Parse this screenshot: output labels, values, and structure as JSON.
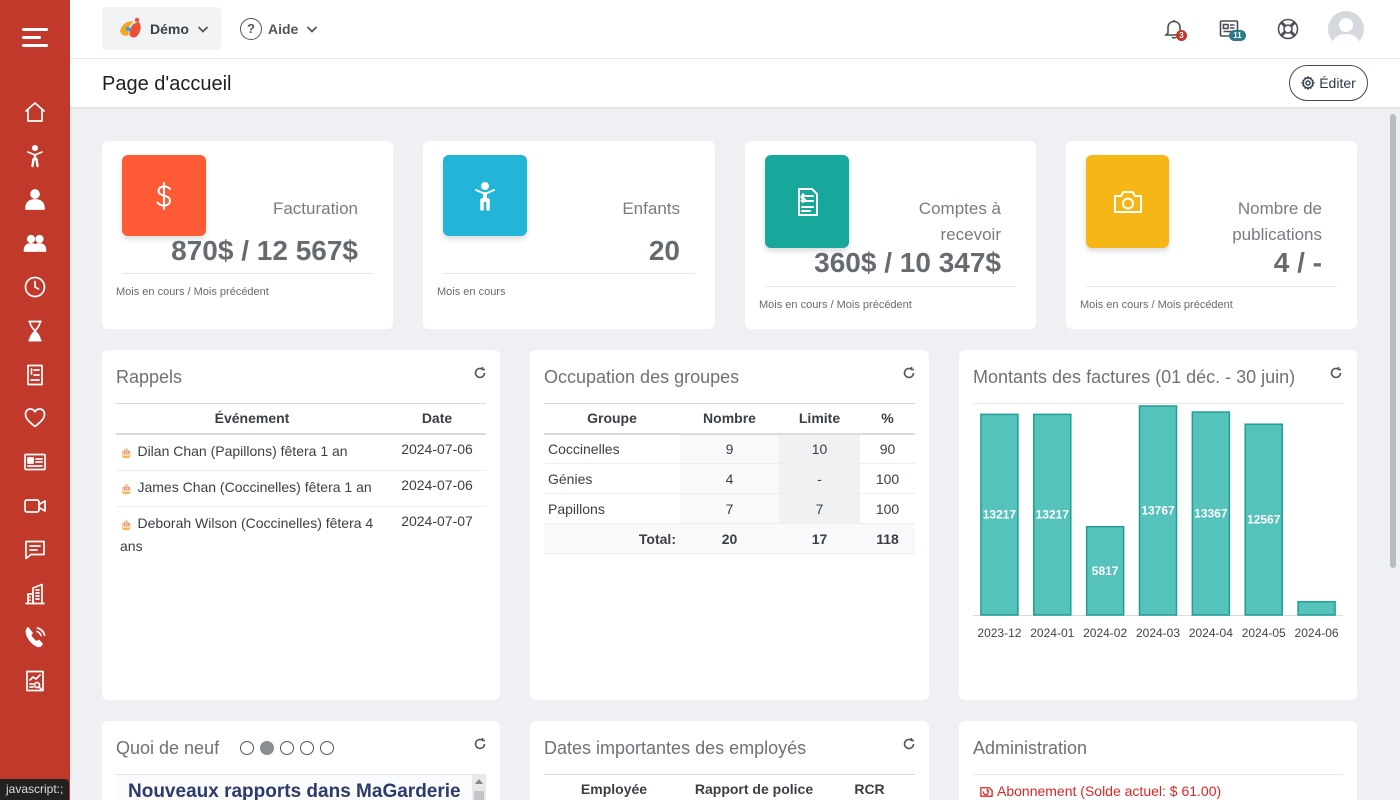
{
  "sidebar": {
    "items": [
      "home-icon",
      "child-icon",
      "users-icon",
      "group-icon",
      "clock-icon",
      "hourglass-icon",
      "invoice-icon",
      "heart-icon",
      "id-card-icon",
      "video-icon",
      "chat-icon",
      "building-icon",
      "phone-icon",
      "report-icon"
    ]
  },
  "status_bar": "javascript:;",
  "topbar": {
    "org_label": "Démo",
    "help_label": "Aide",
    "notifications_count": "3",
    "messages_count": "11"
  },
  "page": {
    "title": "Page d'accueil",
    "edit_label": "Éditer"
  },
  "stats": [
    {
      "title": "Facturation",
      "value": "870$ / 12 567$",
      "footer": "Mois en cours / Mois précédent",
      "color": "#fd5a35",
      "icon": "dollar-icon"
    },
    {
      "title": "Enfants",
      "value": "20",
      "footer": "Mois en cours",
      "color": "#22b5d8",
      "icon": "child-icon"
    },
    {
      "title_line1": "Comptes à",
      "title_line2": "recevoir",
      "value": "360$ / 10 347$",
      "footer": "Mois en cours / Mois précédent",
      "color": "#17a89b",
      "icon": "invoice-icon"
    },
    {
      "title_line1": "Nombre de",
      "title_line2": "publications",
      "value": "4 / -",
      "footer": "Mois en cours / Mois précédent",
      "color": "#f6b716",
      "icon": "camera-icon"
    }
  ],
  "reminders": {
    "title": "Rappels",
    "headers": [
      "Événement",
      "Date"
    ],
    "rows": [
      {
        "event": "Dilan Chan (Papillons) fêtera 1 an",
        "date": "2024-07-06"
      },
      {
        "event": "James Chan (Coccinelles) fêtera 1 an",
        "date": "2024-07-06"
      },
      {
        "event": "Deborah Wilson (Coccinelles) fêtera 4 ans",
        "date": "2024-07-07"
      }
    ]
  },
  "occupancy": {
    "title": "Occupation des groupes",
    "headers": [
      "Groupe",
      "Nombre",
      "Limite",
      "%"
    ],
    "rows": [
      {
        "group": "Coccinelles",
        "count": "9",
        "limit": "10",
        "pct": "90"
      },
      {
        "group": "Génies",
        "count": "4",
        "limit": "-",
        "pct": "100"
      },
      {
        "group": "Papillons",
        "count": "7",
        "limit": "7",
        "pct": "100"
      }
    ],
    "total": {
      "label": "Total:",
      "count": "20",
      "limit": "17",
      "pct": "118"
    }
  },
  "invoices": {
    "title": "Montants des factures (01 déc. - 30 juin)"
  },
  "chart_data": {
    "type": "bar",
    "title": "Montants des factures (01 déc. - 30 juin)",
    "categories": [
      "2023-12",
      "2024-01",
      "2024-02",
      "2024-03",
      "2024-04",
      "2024-05",
      "2024-06"
    ],
    "values": [
      13217,
      13217,
      5817,
      13767,
      13367,
      12567,
      870
    ],
    "data_labels": [
      "13217",
      "13217",
      "5817",
      "13767",
      "13367",
      "12567",
      ""
    ],
    "ylim": [
      0,
      13767
    ],
    "bar_color": "#55c2bb",
    "bar_border": "#1f9e94",
    "grid": false
  },
  "news": {
    "title": "Quoi de neuf",
    "headline": "Nouveaux rapports dans MaGarderie",
    "dots": 5,
    "active_dot": 1
  },
  "employees": {
    "title": "Dates importantes des employés",
    "headers": [
      "Employée",
      "Rapport de police",
      "RCR"
    ]
  },
  "admin": {
    "title": "Administration",
    "subscription": "Abonnement (Solde actuel: $ 61.00)"
  }
}
